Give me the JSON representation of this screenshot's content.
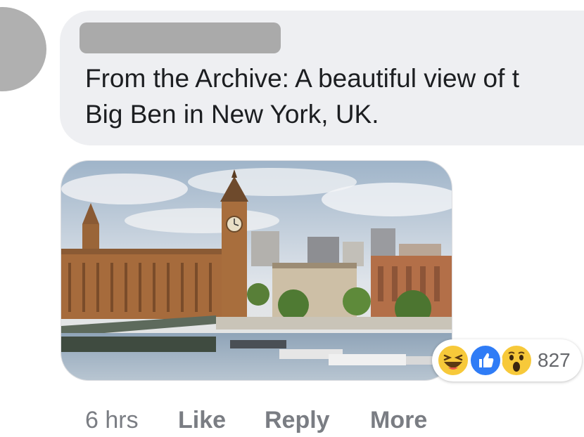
{
  "comment": {
    "author_redacted": true,
    "text": "From the Archive: A beautiful view of t\nBig Ben in New York, UK.",
    "image_alt": "Photo of Big Ben and the Houses of Parliament by the River Thames",
    "reactions": {
      "types": [
        "haha",
        "like",
        "wow"
      ],
      "count": "827"
    },
    "meta": {
      "time": "6 hrs",
      "like_label": "Like",
      "reply_label": "Reply",
      "more_label": "More"
    }
  },
  "colors": {
    "bubble": "#eeeff2",
    "text": "#1c1e21",
    "muted": "#7a7d83",
    "like_blue": "#2f7cf6",
    "emoji_yellow": "#f7c93a",
    "avatar": "#b0b0b0",
    "redaction": "#aaaaaa"
  }
}
